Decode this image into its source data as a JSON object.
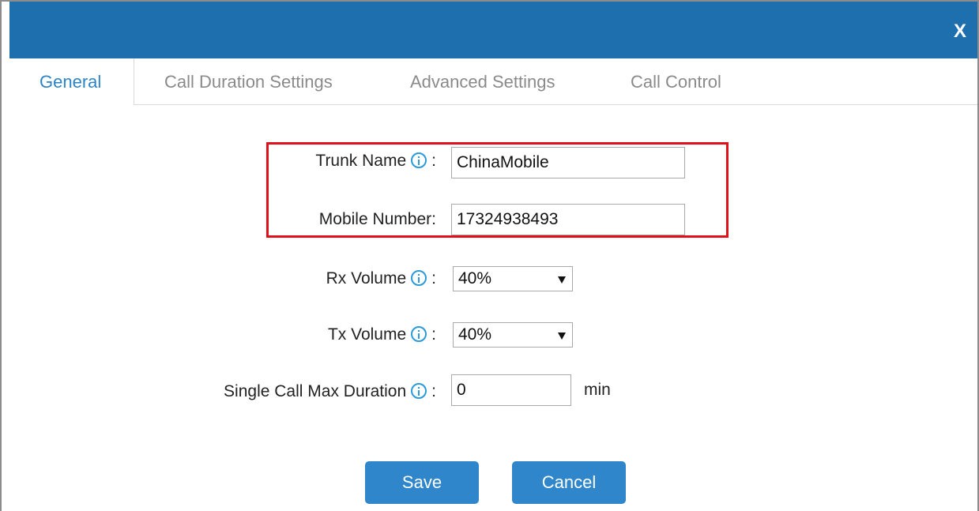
{
  "dialog": {
    "close_label": "X"
  },
  "tabs": [
    {
      "label": "General",
      "active": true
    },
    {
      "label": "Call Duration Settings",
      "active": false
    },
    {
      "label": "Advanced Settings",
      "active": false
    },
    {
      "label": "Call Control",
      "active": false
    }
  ],
  "form": {
    "trunk_name": {
      "label": "Trunk Name",
      "colon": ":",
      "value": "ChinaMobile"
    },
    "mobile_number": {
      "label": "Mobile Number:",
      "value": "17324938493"
    },
    "rx_volume": {
      "label": "Rx Volume",
      "colon": ":",
      "value": "40%"
    },
    "tx_volume": {
      "label": "Tx Volume",
      "colon": ":",
      "value": "40%"
    },
    "max_duration": {
      "label": "Single Call Max Duration",
      "colon": ":",
      "value": "0",
      "unit": "min"
    }
  },
  "buttons": {
    "save": "Save",
    "cancel": "Cancel"
  },
  "colors": {
    "titlebar": "#1e6fae",
    "active_tab": "#2c83c6",
    "button": "#2f86cb",
    "highlight": "#e0101b",
    "info_icon": "#2b9ad8"
  }
}
